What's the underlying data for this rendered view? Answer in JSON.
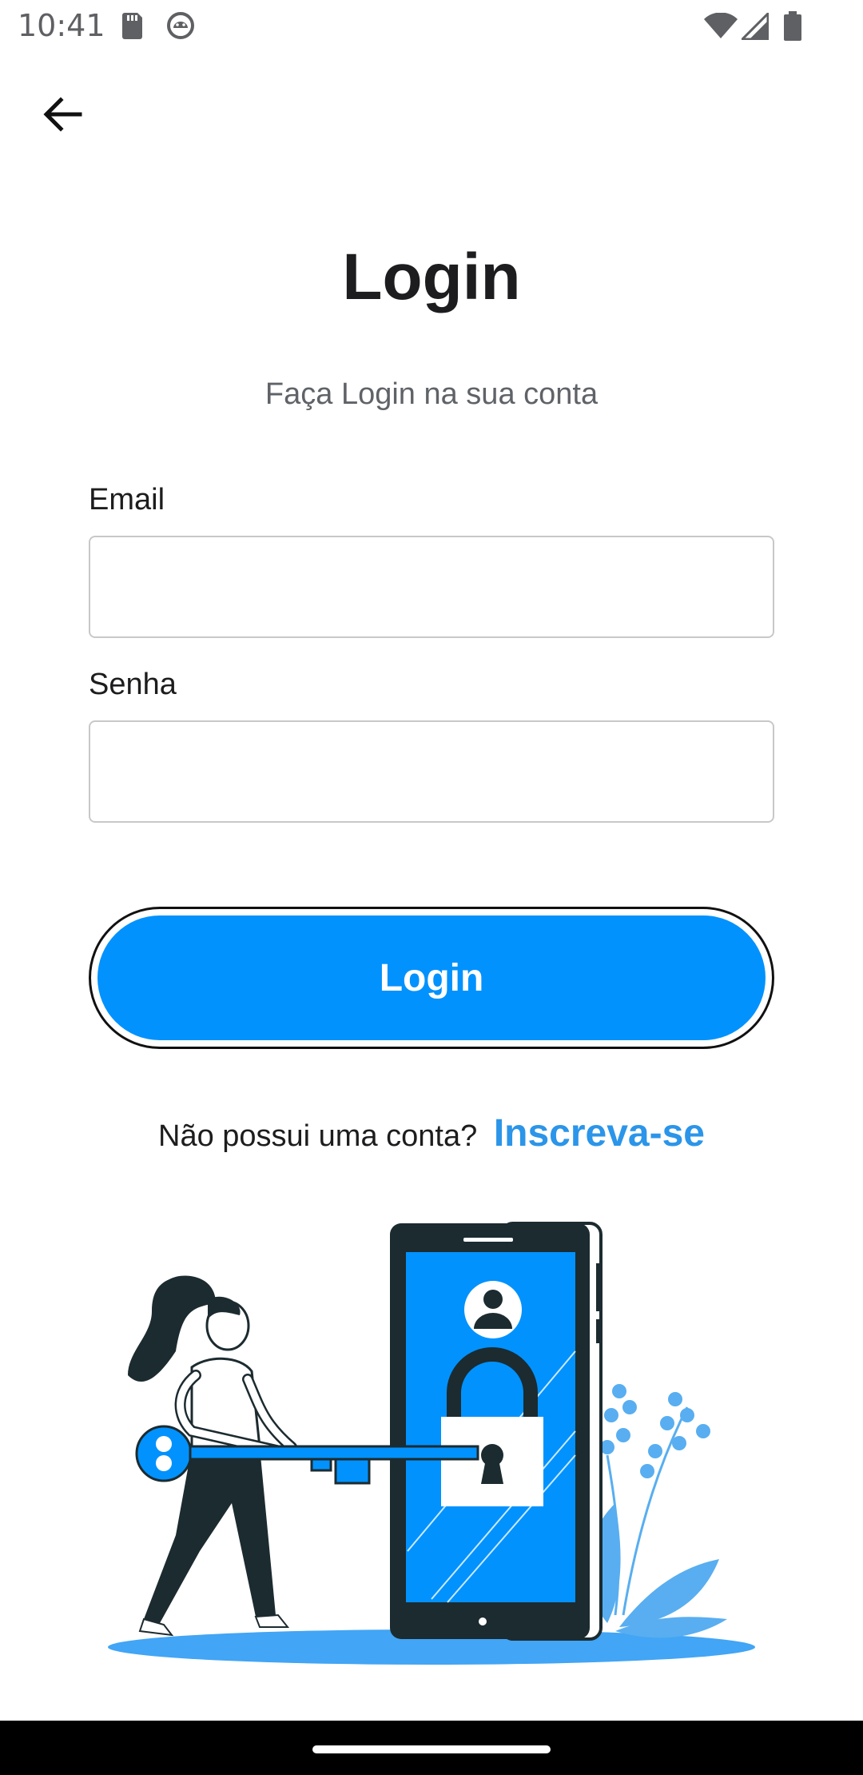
{
  "status_bar": {
    "time": "10:41",
    "icons": [
      "sd-card-icon",
      "android-debug-icon",
      "wifi-icon",
      "signal-icon",
      "battery-icon"
    ]
  },
  "header": {
    "back_icon": "arrow-left-icon"
  },
  "login": {
    "title": "Login",
    "subtitle": "Faça Login na sua conta",
    "email_label": "Email",
    "email_value": "",
    "password_label": "Senha",
    "password_value": "",
    "button_label": "Login",
    "signup_prompt": "Não possui uma conta?",
    "signup_link": "Inscreva-se"
  },
  "colors": {
    "accent": "#0292fd",
    "link": "#2b95e9",
    "text": "#1d1d1f",
    "subtitle": "#5f6368",
    "border": "#c8c8c8"
  },
  "illustration": {
    "icon": "login-security-illustration"
  }
}
